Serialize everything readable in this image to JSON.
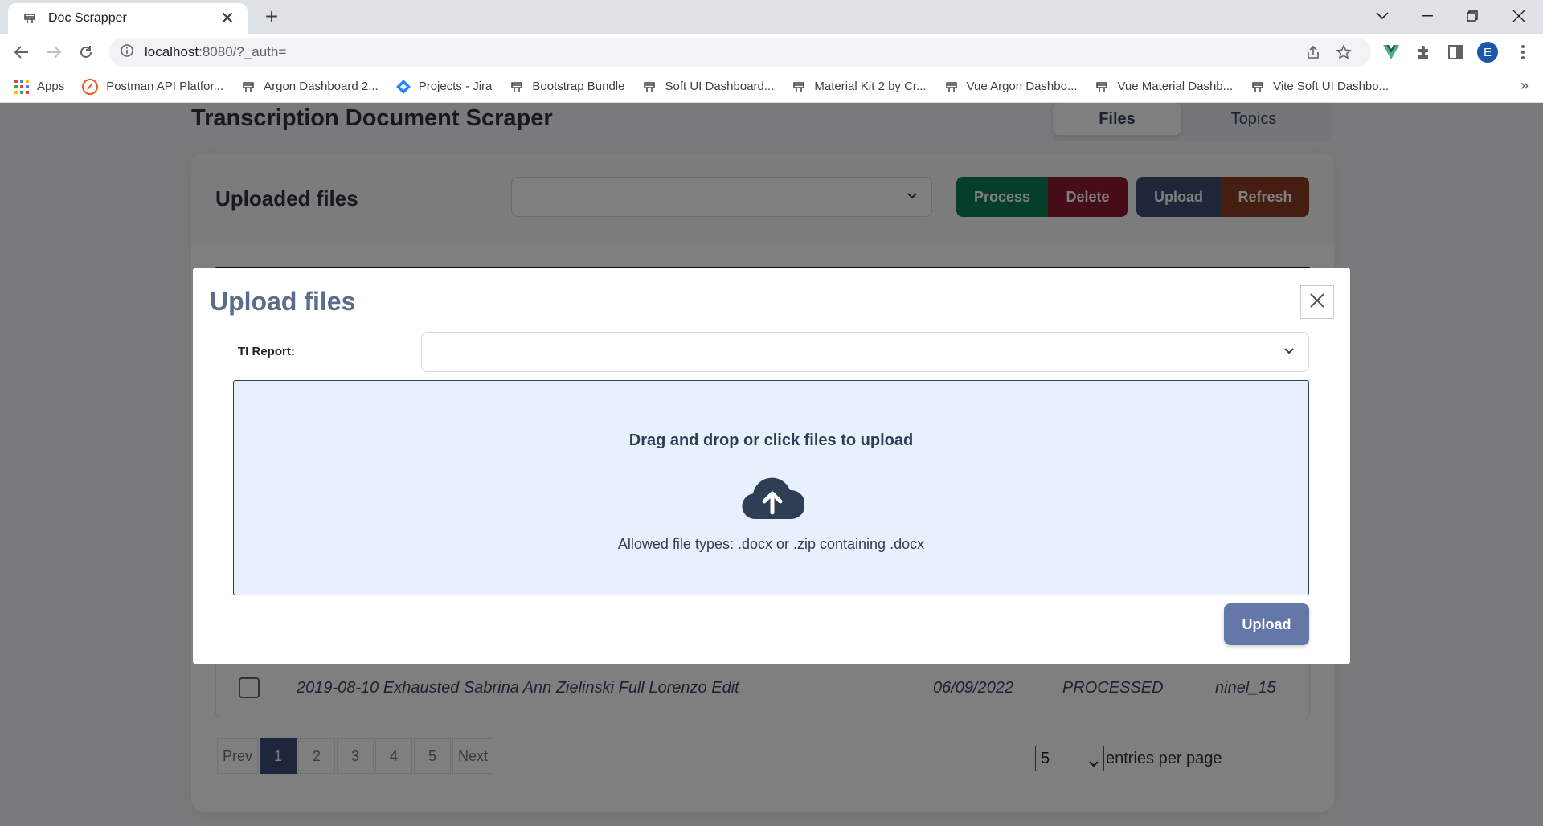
{
  "browser": {
    "tab_title": "Doc Scrapper",
    "url_host": "localhost",
    "url_rest": ":8080/?_auth=",
    "bookmarks": [
      {
        "label": "Apps",
        "icon": "apps-grid-icon"
      },
      {
        "label": "Postman API Platfor...",
        "icon": "postman-icon"
      },
      {
        "label": "Argon Dashboard 2...",
        "icon": "creative-tim-icon"
      },
      {
        "label": "Projects - Jira",
        "icon": "jira-icon"
      },
      {
        "label": "Bootstrap Bundle",
        "icon": "creative-tim-icon"
      },
      {
        "label": "Soft UI Dashboard...",
        "icon": "creative-tim-icon"
      },
      {
        "label": "Material Kit 2 by Cr...",
        "icon": "creative-tim-icon"
      },
      {
        "label": "Vue Argon Dashbo...",
        "icon": "creative-tim-icon"
      },
      {
        "label": "Vue Material Dashb...",
        "icon": "creative-tim-icon"
      },
      {
        "label": "Vite Soft UI Dashbo...",
        "icon": "creative-tim-icon"
      }
    ],
    "bookmarks_more": "»",
    "avatar_letter": "E"
  },
  "app": {
    "title": "Transcription Document Scraper",
    "tabs": [
      "Files",
      "Topics"
    ],
    "active_tab": "Files"
  },
  "files_card": {
    "title": "Uploaded files",
    "select_value": "",
    "buttons": {
      "process": "Process",
      "delete": "Delete",
      "upload": "Upload",
      "refresh": "Refresh"
    },
    "visible_row": {
      "name": "2019-08-10 Exhausted Sabrina Ann Zielinski Full Lorenzo Edit",
      "date": "06/09/2022",
      "status": "PROCESSED",
      "user": "ninel_15"
    },
    "pagination": {
      "prev": "Prev",
      "pages": [
        "1",
        "2",
        "3",
        "4",
        "5"
      ],
      "current": "1",
      "next": "Next"
    },
    "entries_per_page": {
      "value": "5",
      "label": "entries per page"
    }
  },
  "modal": {
    "title": "Upload files",
    "report_label": "TI Report:",
    "report_value": "",
    "dropzone_title": "Drag and drop or click files to upload",
    "allowed_types": "Allowed file types: .docx or .zip containing .docx",
    "upload_button": "Upload"
  },
  "colors": {
    "process": "#0b7d52",
    "delete": "#8c1a33",
    "upload": "#3f4c74",
    "refresh": "#8b3a22",
    "pager_active": "#3e4d78",
    "modal_upload": "#6377a8",
    "dropzone_bg": "#e8f0fe"
  }
}
